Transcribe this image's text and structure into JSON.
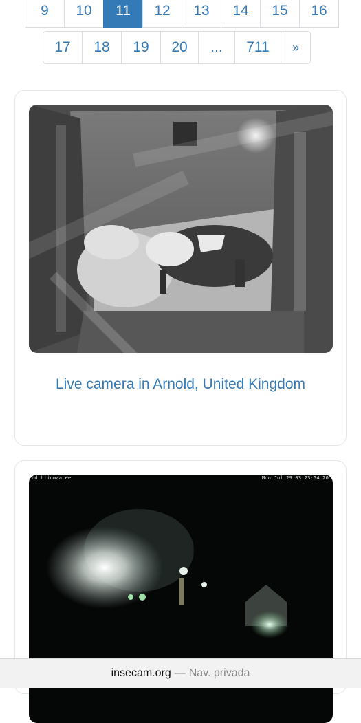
{
  "pagination": {
    "row1": [
      {
        "label": "9",
        "active": false
      },
      {
        "label": "10",
        "active": false
      },
      {
        "label": "11",
        "active": true
      },
      {
        "label": "12",
        "active": false
      },
      {
        "label": "13",
        "active": false
      },
      {
        "label": "14",
        "active": false
      },
      {
        "label": "15",
        "active": false
      },
      {
        "label": "16",
        "active": false
      }
    ],
    "row2": [
      {
        "label": "17"
      },
      {
        "label": "18"
      },
      {
        "label": "19"
      },
      {
        "label": "20"
      },
      {
        "label": "..."
      },
      {
        "label": "711"
      },
      {
        "label": "»"
      }
    ]
  },
  "cameras": [
    {
      "caption": "Live camera in Arnold, United Kingdom"
    },
    {
      "overlay_left": "hd.hiiumaa.ee",
      "overlay_right": "Mon Jul 29 03:23:54 20"
    }
  ],
  "browser_bar": {
    "domain": "insecam.org",
    "separator": "—",
    "mode": "Nav. privada"
  },
  "colors": {
    "link": "#337ab7",
    "active_page_bg": "#337ab7",
    "card_border": "#e3e6ea",
    "bar_bg": "#f2f2f2"
  }
}
